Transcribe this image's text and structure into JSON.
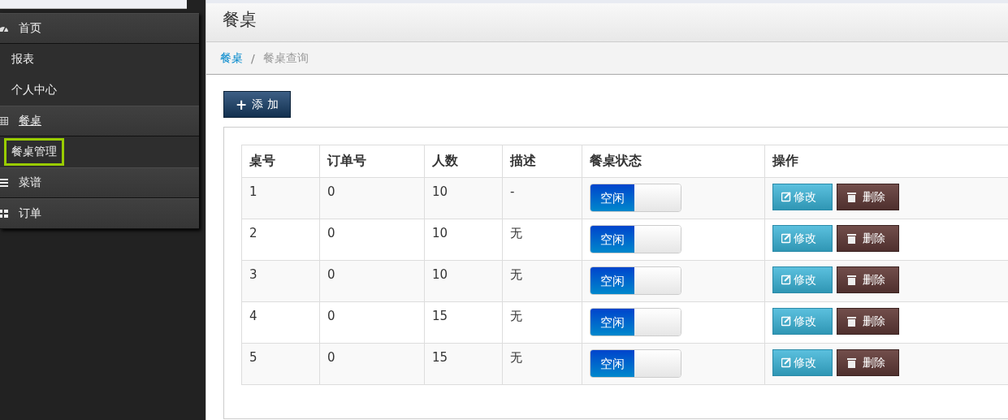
{
  "sidebar": {
    "items": [
      {
        "label": "首页",
        "selected": false,
        "children": [
          {
            "label": "报表",
            "selected": false
          },
          {
            "label": "个人中心",
            "selected": false
          }
        ]
      },
      {
        "label": "餐桌",
        "selected": true,
        "children": [
          {
            "label": "餐桌管理",
            "selected": true
          }
        ]
      },
      {
        "label": "菜谱",
        "selected": false
      },
      {
        "label": "订单",
        "selected": false
      }
    ]
  },
  "page": {
    "title": "餐桌",
    "breadcrumb": [
      {
        "label": "餐桌",
        "kind": "link"
      },
      {
        "label": "/",
        "kind": "separator"
      },
      {
        "label": "餐桌查询",
        "kind": "text"
      }
    ]
  },
  "add_button": {
    "icon": "+",
    "label": "添 加"
  },
  "table": {
    "columns": [
      "桌号",
      "订单号",
      "人数",
      "描述",
      "餐桌状态",
      "操作"
    ],
    "rows": [
      {
        "cells": [
          "1",
          "0",
          "10",
          "-"
        ],
        "status": {
          "label": "空闲",
          "on": true
        },
        "edit": "修改",
        "delete": "删除"
      },
      {
        "cells": [
          "2",
          "0",
          "10",
          "无"
        ],
        "status": {
          "label": "空闲",
          "on": true
        },
        "edit": "修改",
        "delete": "删除"
      },
      {
        "cells": [
          "3",
          "0",
          "10",
          "无"
        ],
        "status": {
          "label": "空闲",
          "on": true
        },
        "edit": "修改",
        "delete": "删除"
      },
      {
        "cells": [
          "4",
          "0",
          "15",
          "无"
        ],
        "status": {
          "label": "空闲",
          "on": true
        },
        "edit": "修改",
        "delete": "删除"
      },
      {
        "cells": [
          "5",
          "0",
          "15",
          "无"
        ],
        "status": {
          "label": "空闲",
          "on": true
        },
        "edit": "修改",
        "delete": "删除"
      }
    ]
  }
}
